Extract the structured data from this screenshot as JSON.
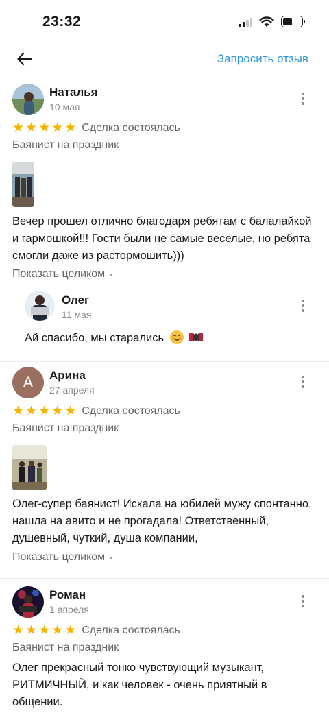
{
  "status_bar": {
    "time": "23:32"
  },
  "nav": {
    "request_label": "Запросить отзыв"
  },
  "common": {
    "deal_status": "Сделка состоялась",
    "show_more": "Показать целиком"
  },
  "reviews": [
    {
      "author": "Наталья",
      "date": "10 мая",
      "rating": 5,
      "service": "Баянист на праздник",
      "text": "Вечер прошел отлично благодаря ребятам с балалайкой и гармошкой!!! Гости были не самые веселые, но ребята смогли даже из растормошить)))",
      "reply": {
        "author": "Олег",
        "date": "11 мая",
        "text": "Ай спасибо, мы старались"
      }
    },
    {
      "author": "Арина",
      "avatar_letter": "А",
      "date": "27 апреля",
      "rating": 5,
      "service": "Баянист на праздник",
      "text": "Олег-супер баянист! Искала на юбилей мужу спонтанно, нашла на авито и не прогадала! Ответственный, душевный, чуткий, душа компании,"
    },
    {
      "author": "Роман",
      "date": "1 апреля",
      "rating": 5,
      "service": "Баянист на праздник",
      "text": "Олег прекрасный тонко чувствующий музыкант, РИТМИЧНЫЙ, и как человек - очень приятный в общении."
    }
  ],
  "colors": {
    "accent": "#2f9bd6",
    "star": "#f5b400",
    "secondary_text": "#666666",
    "avatar_letter_bg": "#9b6f60"
  }
}
